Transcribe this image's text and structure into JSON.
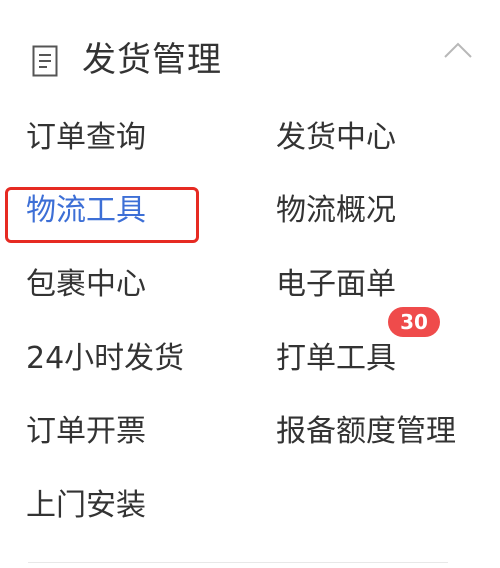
{
  "section": {
    "title": "发货管理",
    "icon": "document-list-icon",
    "collapse_icon": "chevron-up-icon"
  },
  "menu": {
    "items": [
      {
        "label": "订单查询"
      },
      {
        "label": "发货中心"
      },
      {
        "label": "物流工具"
      },
      {
        "label": "物流概况"
      },
      {
        "label": "包裹中心"
      },
      {
        "label": "电子面单"
      },
      {
        "label": "24小时发货"
      },
      {
        "label": "打单工具"
      },
      {
        "label": "订单开票"
      },
      {
        "label": "报备额度管理"
      },
      {
        "label": "上门安装"
      }
    ],
    "active_item": "物流工具",
    "badge": {
      "item": "打单工具",
      "count": "30"
    }
  },
  "colors": {
    "active_text": "#3d6fd6",
    "highlight_border": "#e62a22",
    "badge_bg": "#ef4b4b"
  }
}
